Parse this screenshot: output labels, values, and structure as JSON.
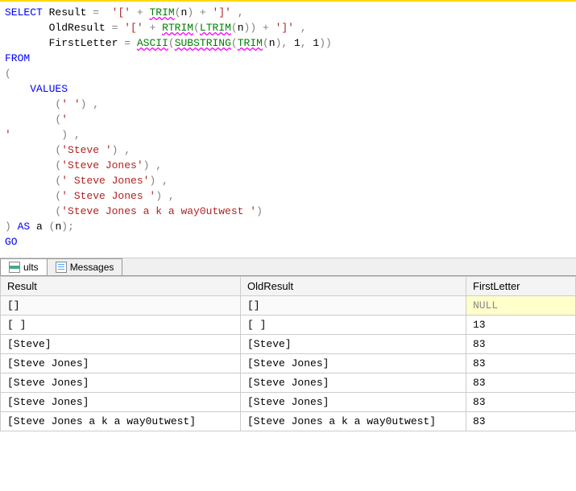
{
  "editor": {
    "line1_select": "SELECT",
    "line1_result": " Result ",
    "line1_eq": "=",
    "line1_sp": "  ",
    "line1_lit1": "'['",
    "line1_plus": " + ",
    "line1_trim": "TRIM",
    "line1_lp": "(",
    "line1_n": "n",
    "line1_rp": ")",
    "line1_lit2": "']'",
    "line1_comma": " ,",
    "line2_old": "       OldResult ",
    "line2_eq": "=",
    "line2_sp": " ",
    "line2_lit1": "'['",
    "line2_plus": " + ",
    "line2_rtrim": "RTRIM",
    "line2_lp": "(",
    "line2_ltrim": "LTRIM",
    "line2_n": "n",
    "line2_rp": ")",
    "line2_lit2": "']'",
    "line2_comma": " ,",
    "line3_first": "       FirstLetter ",
    "line3_eq": "=",
    "line3_sp": " ",
    "line3_ascii": "ASCII",
    "line3_lp": "(",
    "line3_substring": "SUBSTRING",
    "line3_trim": "TRIM",
    "line3_n": "n",
    "line3_comma": ",",
    "line3_one": " 1",
    "line3_rp": ")",
    "line4_from": "FROM",
    "line5_lp": "(",
    "line6_values": "    VALUES",
    "line7": "        (",
    "line7_lit": "' '",
    "line7_end": ") ,",
    "line8": "        (",
    "line8_lit": "'",
    "line9_lit": "'",
    "line9_end": "        ) ,",
    "line10": "        (",
    "line10_lit": "'Steve '",
    "line10_end": ") ,",
    "line11": "        (",
    "line11_lit": "'Steve Jones'",
    "line11_end": ") ,",
    "line12": "        (",
    "line12_lit": "' Steve Jones'",
    "line12_end": ") ,",
    "line13": "        (",
    "line13_lit": "' Steve Jones '",
    "line13_end": ") ,",
    "line14": "        (",
    "line14_lit": "'Steve Jones a k a way0utwest '",
    "line14_end": ")",
    "line15_rp": ")",
    "line15_as": " AS",
    "line15_a": " a ",
    "line15_lp2": "(",
    "line15_n": "n",
    "line15_rp2": ")",
    "line15_semi": ";",
    "line16_go": "GO"
  },
  "tabs": {
    "results": "ults",
    "messages": "Messages"
  },
  "grid": {
    "headers": {
      "result": "Result",
      "oldresult": "OldResult",
      "firstletter": "FirstLetter"
    },
    "rows": [
      {
        "result": "[]",
        "oldresult": "[]",
        "firstletter": "NULL",
        "null": true
      },
      {
        "result": "[  ]",
        "oldresult": "[  ]",
        "firstletter": "13"
      },
      {
        "result": "[Steve]",
        "oldresult": "[Steve]",
        "firstletter": "83"
      },
      {
        "result": "[Steve Jones]",
        "oldresult": "[Steve Jones]",
        "firstletter": "83"
      },
      {
        "result": "[Steve Jones]",
        "oldresult": "[Steve Jones]",
        "firstletter": "83"
      },
      {
        "result": "[Steve Jones]",
        "oldresult": "[Steve Jones]",
        "firstletter": "83"
      },
      {
        "result": "[Steve Jones a k a way0utwest]",
        "oldresult": "[Steve Jones a k a way0utwest]",
        "firstletter": "83"
      }
    ]
  }
}
